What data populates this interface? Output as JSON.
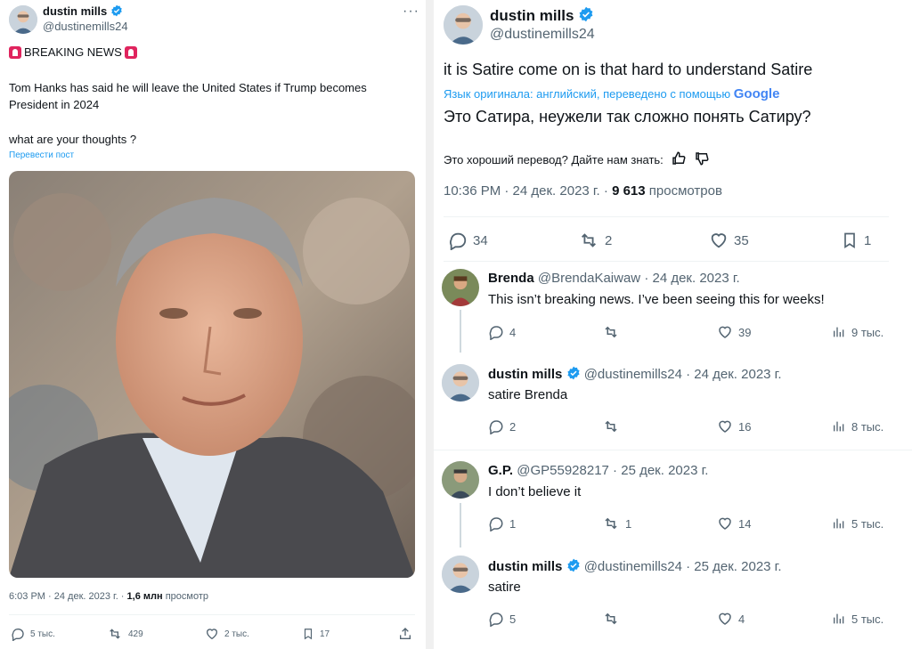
{
  "left_tweet": {
    "author_name": "dustin mills",
    "author_handle": "@dustinemills24",
    "more_icon": "ellipsis-icon",
    "breaking_line": "BREAKING NEWS",
    "siren_icon": "siren-emoji",
    "body_line1": "Tom Hanks has said he will leave the United States if Trump becomes",
    "body_line2": "President in 2024",
    "body_line3": "what are your thoughts ?",
    "translate_link": "Перевести пост",
    "meta_time": "6:03 PM · 24 дек. 2023 г. · ",
    "meta_views_count": "1,6 млн",
    "meta_views_label": " просмотр",
    "actions": {
      "reply": "5 тыс.",
      "retweet": "429",
      "like": "2 тыс.",
      "bookmark": "17"
    }
  },
  "right_tweet": {
    "author_name": "dustin mills",
    "author_handle": "@dustinemills24",
    "text": "it is Satire come on is that hard to understand Satire",
    "translated_note": "Язык оригинала: английский, переведено с помощью",
    "google_label": "Google",
    "translated_text": "Это Сатира, неужели так сложно понять Сатиру?",
    "feedback_question": "Это хороший перевод? Дайте нам знать:",
    "meta_time": "10:36 PM · 24 дек. 2023 г. · ",
    "meta_views_count": "9 613",
    "meta_views_label": " просмотров",
    "actions": {
      "reply": "34",
      "retweet": "2",
      "like": "35",
      "bookmark": "1"
    }
  },
  "replies": [
    {
      "name": "Brenda",
      "handle": "@BrendaKaiwaw",
      "date": " · 24 дек. 2023 г.",
      "text": "This isn’t breaking news. I’ve been seeing this for weeks!",
      "reply": "4",
      "retweet": "",
      "like": "39",
      "views": "9 тыс.",
      "verified": false
    },
    {
      "name": "dustin mills",
      "handle": "@dustinemills24",
      "date": " · 24 дек. 2023 г.",
      "text": "satire Brenda",
      "reply": "2",
      "retweet": "",
      "like": "16",
      "views": "8 тыс.",
      "verified": true
    },
    {
      "name": "G.P.",
      "handle": "@GP55928217",
      "date": " · 25 дек. 2023 г.",
      "text": "I don’t believe it",
      "reply": "1",
      "retweet": "1",
      "like": "14",
      "views": "5 тыс.",
      "verified": false
    },
    {
      "name": "dustin mills",
      "handle": "@dustinemills24",
      "date": " · 25 дек. 2023 г.",
      "text": "satire",
      "reply": "5",
      "retweet": "",
      "like": "4",
      "views": "5 тыс.",
      "verified": true
    }
  ],
  "colors": {
    "verified_blue": "#1d9bf0",
    "muted_text": "#536471",
    "link_blue": "#1d9bf0"
  }
}
